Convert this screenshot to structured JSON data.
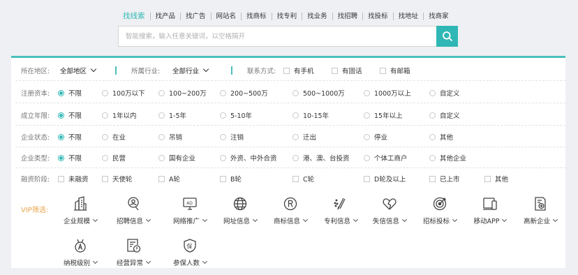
{
  "tabs": [
    "找线索",
    "找产品",
    "找广告",
    "网站名",
    "找商标",
    "找专利",
    "找业务",
    "找招聘",
    "找投标",
    "找地址",
    "找商家"
  ],
  "search": {
    "placeholder": "智能搜索，输入任意关键词，以空格隔开"
  },
  "filters": {
    "region": {
      "label": "所在地区:",
      "value": "全部地区"
    },
    "industry": {
      "label": "所属行业:",
      "value": "全部行业"
    },
    "contact": {
      "label": "联系方式:",
      "options": [
        "有手机",
        "有固话",
        "有邮箱"
      ]
    }
  },
  "rows": {
    "capital": {
      "label": "注册资本:",
      "options": [
        "不限",
        "100万以下",
        "100~200万",
        "200~500万",
        "500~1000万",
        "1000万以上",
        "自定义"
      ]
    },
    "years": {
      "label": "成立年限:",
      "options": [
        "不限",
        "1年以内",
        "1-5年",
        "5-10年",
        "10-15年",
        "15年以上",
        "自定义"
      ]
    },
    "status": {
      "label": "企业状态:",
      "options": [
        "不限",
        "在业",
        "吊销",
        "注销",
        "迁出",
        "停业",
        "其他"
      ]
    },
    "type": {
      "label": "企业类型:",
      "options": [
        "不限",
        "民营",
        "国有企业",
        "外资、中外合资",
        "港、澳、台投资",
        "个体工商户",
        "其他企业"
      ]
    },
    "funding": {
      "label": "融资阶段:",
      "options": [
        "未融资",
        "天使轮",
        "A轮",
        "B轮",
        "C轮",
        "D轮及以上",
        "已上市",
        "其他"
      ]
    }
  },
  "vip": {
    "label": "VIP筛选:",
    "items": [
      {
        "label": "企业规模",
        "icon": "building-icon"
      },
      {
        "label": "招聘信息",
        "icon": "recruit-search-icon"
      },
      {
        "label": "网络推广",
        "icon": "ad-screen-icon"
      },
      {
        "label": "网址信息",
        "icon": "globe-icon"
      },
      {
        "label": "商标信息",
        "icon": "registered-trademark-icon"
      },
      {
        "label": "专利信息",
        "icon": "patent-pen-icon"
      },
      {
        "label": "失信信息",
        "icon": "broken-heart-icon"
      },
      {
        "label": "招标投标",
        "icon": "target-icon"
      },
      {
        "label": "移动APP",
        "icon": "mobile-app-icon"
      },
      {
        "label": "高新企业",
        "icon": "hightech-cert-icon"
      },
      {
        "label": "纳税级别",
        "icon": "tax-medal-icon"
      },
      {
        "label": "经营异常",
        "icon": "abnormal-doc-icon"
      },
      {
        "label": "参保人数",
        "icon": "insurance-shield-icon"
      }
    ]
  },
  "colors": {
    "accent": "#2fb7b5",
    "vip": "#e8a54a"
  }
}
